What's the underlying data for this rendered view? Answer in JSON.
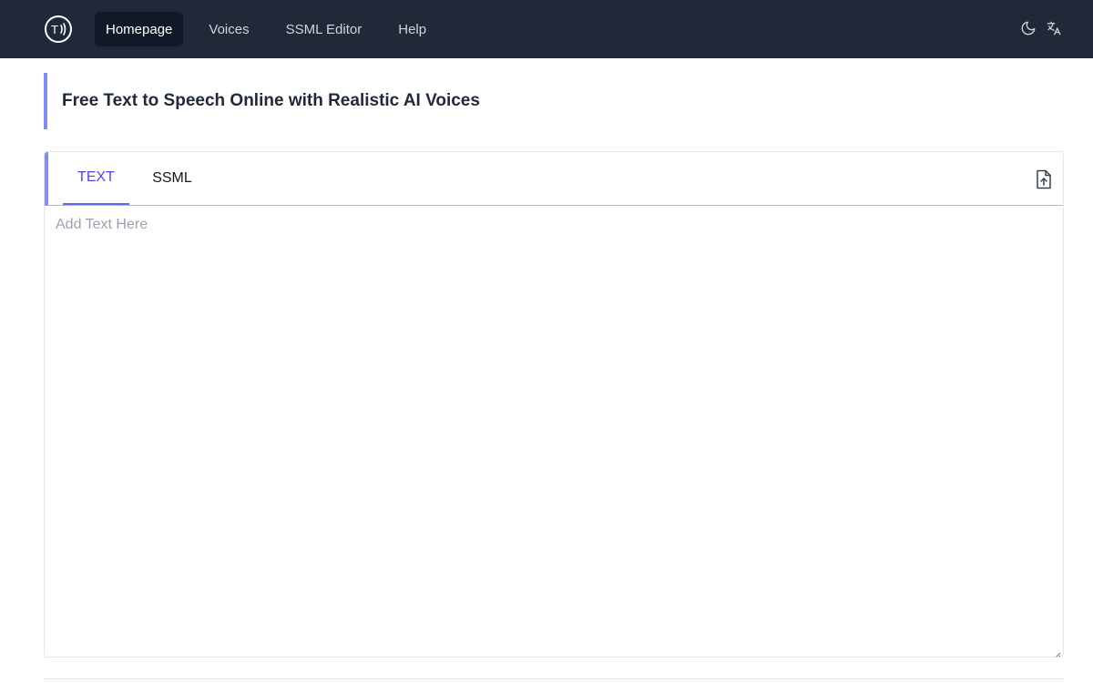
{
  "nav": {
    "logo_text": "T",
    "links": [
      {
        "label": "Homepage",
        "active": true
      },
      {
        "label": "Voices",
        "active": false
      },
      {
        "label": "SSML Editor",
        "active": false
      },
      {
        "label": "Help",
        "active": false
      }
    ],
    "icons": [
      "moon-icon",
      "translate-icon"
    ]
  },
  "heading": {
    "title": "Free Text to Speech Online with Realistic AI Voices"
  },
  "editor": {
    "tabs": [
      {
        "label": "TEXT",
        "active": true
      },
      {
        "label": "SSML",
        "active": false
      }
    ],
    "placeholder": "Add Text Here",
    "value": "",
    "upload_icon": "file-upload-icon"
  },
  "colors": {
    "nav_bg": "#1f2937",
    "accent": "#818cf8",
    "active_tab": "#4f46e5"
  }
}
